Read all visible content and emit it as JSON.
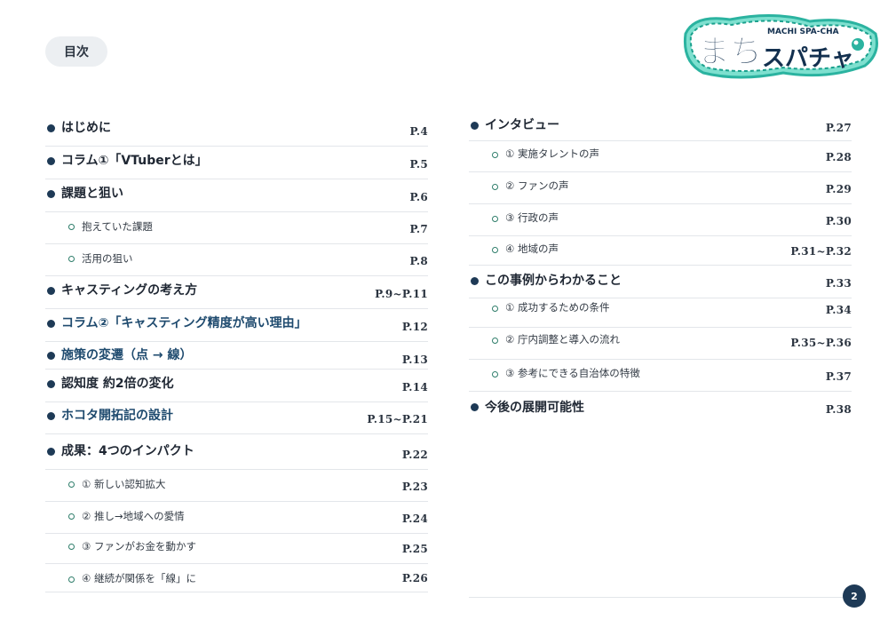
{
  "header": {
    "toc_label": "目次",
    "logo": {
      "main_text": "まちスパチャ",
      "sub_text": "MACHI SPA-CHA",
      "colors": {
        "teal": "#2bb3a0",
        "navy": "#13304f",
        "mint": "#7ee0cf"
      }
    }
  },
  "toc_left": [
    {
      "label": "はじめに",
      "page": "P.4",
      "level": "main"
    },
    {
      "label": "コラム①「VTuberとは」",
      "page": "P.5",
      "level": "main"
    },
    {
      "label": "課題と狙い",
      "page": "P.6",
      "level": "main"
    },
    {
      "label": "抱えていた課題",
      "page": "P.7",
      "level": "sub"
    },
    {
      "label": "活用の狙い",
      "page": "P.8",
      "level": "sub"
    },
    {
      "label": "キャスティングの考え方",
      "page": "P.9~P.11",
      "level": "main"
    },
    {
      "label": "コラム②「キャスティング精度が高い理由」",
      "page": "P.12",
      "level": "main"
    },
    {
      "label": "施策の変遷（点 → 線）",
      "page": "P.13",
      "level": "main"
    },
    {
      "label": "認知度 約2倍の変化",
      "page": "P.14",
      "level": "main"
    },
    {
      "label": "ホコタ開拓記の設計",
      "page": "P.15~P.21",
      "level": "main"
    },
    {
      "label": "成果：4つのインパクト",
      "page": "P.22",
      "level": "main"
    },
    {
      "label": "① 新しい認知拡大",
      "page": "P.23",
      "level": "sub"
    },
    {
      "label": "② 推し→地域への愛情",
      "page": "P.24",
      "level": "sub"
    },
    {
      "label": "③ ファンがお金を動かす",
      "page": "P.25",
      "level": "sub"
    },
    {
      "label": "④ 継続が関係を「線」に",
      "page": "P.26",
      "level": "sub"
    }
  ],
  "toc_right": [
    {
      "label": "インタビュー",
      "page": "P.27",
      "level": "main"
    },
    {
      "label": "① 実施タレントの声",
      "page": "P.28",
      "level": "sub"
    },
    {
      "label": "② ファンの声",
      "page": "P.29",
      "level": "sub"
    },
    {
      "label": "③ 行政の声",
      "page": "P.30",
      "level": "sub"
    },
    {
      "label": "④ 地域の声",
      "page": "P.31~P.32",
      "level": "sub"
    },
    {
      "label": "この事例からわかること",
      "page": "P.33",
      "level": "main"
    },
    {
      "label": "① 成功するための条件",
      "page": "P.34",
      "level": "sub"
    },
    {
      "label": "② 庁内調整と導入の流れ",
      "page": "P.35~P.36",
      "level": "sub"
    },
    {
      "label": "③ 参考にできる自治体の特徴",
      "page": "P.37",
      "level": "sub"
    },
    {
      "label": "今後の展開可能性",
      "page": "P.38",
      "level": "main"
    }
  ],
  "footer": {
    "page_number": "2"
  }
}
